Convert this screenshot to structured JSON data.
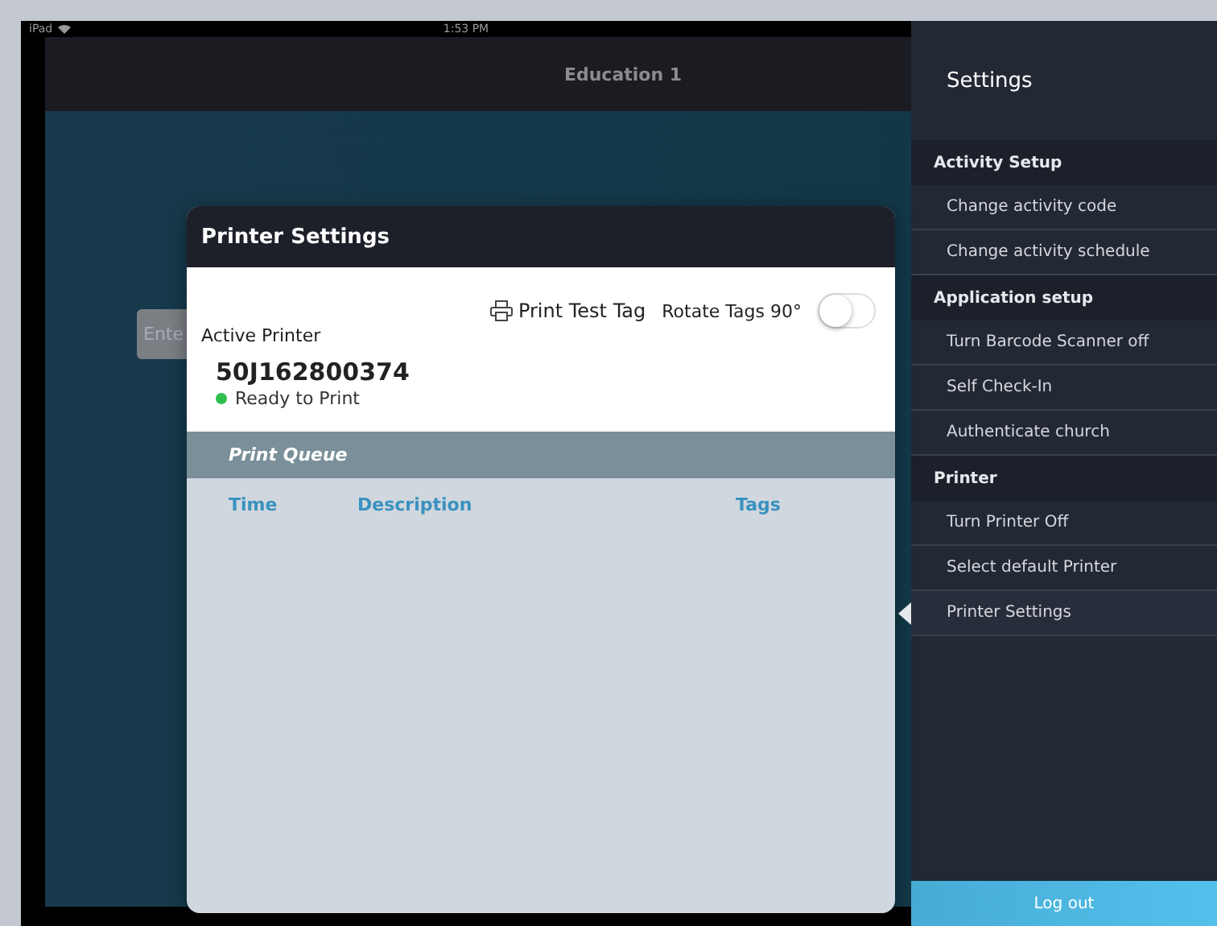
{
  "status_bar": {
    "device": "iPad",
    "time": "1:53 PM"
  },
  "header": {
    "title": "Education 1"
  },
  "background_field": {
    "placeholder": "Ente"
  },
  "modal": {
    "title": "Printer Settings",
    "print_test": "Print Test Tag",
    "rotate": {
      "label": "Rotate Tags 90°",
      "on": false
    },
    "active_printer": {
      "label": "Active Printer",
      "name": "50J162800374",
      "status": "Ready to Print",
      "ready": true
    },
    "queue": {
      "title": "Print Queue",
      "columns": [
        "Time",
        "Description",
        "Tags"
      ]
    }
  },
  "sidebar": {
    "title": "Settings",
    "sections": [
      {
        "title": "Activity Setup",
        "items": [
          {
            "label": "Change activity code",
            "selected": false
          },
          {
            "label": "Change activity schedule",
            "selected": false
          }
        ]
      },
      {
        "title": "Application setup",
        "items": [
          {
            "label": "Turn Barcode Scanner off",
            "selected": false
          },
          {
            "label": "Self Check-In",
            "selected": false
          },
          {
            "label": "Authenticate church",
            "selected": false
          }
        ]
      },
      {
        "title": "Printer",
        "items": [
          {
            "label": "Turn Printer Off",
            "selected": false
          },
          {
            "label": "Select default Printer",
            "selected": false
          },
          {
            "label": "Printer Settings",
            "selected": true
          }
        ]
      }
    ]
  },
  "logout": "Log out"
}
